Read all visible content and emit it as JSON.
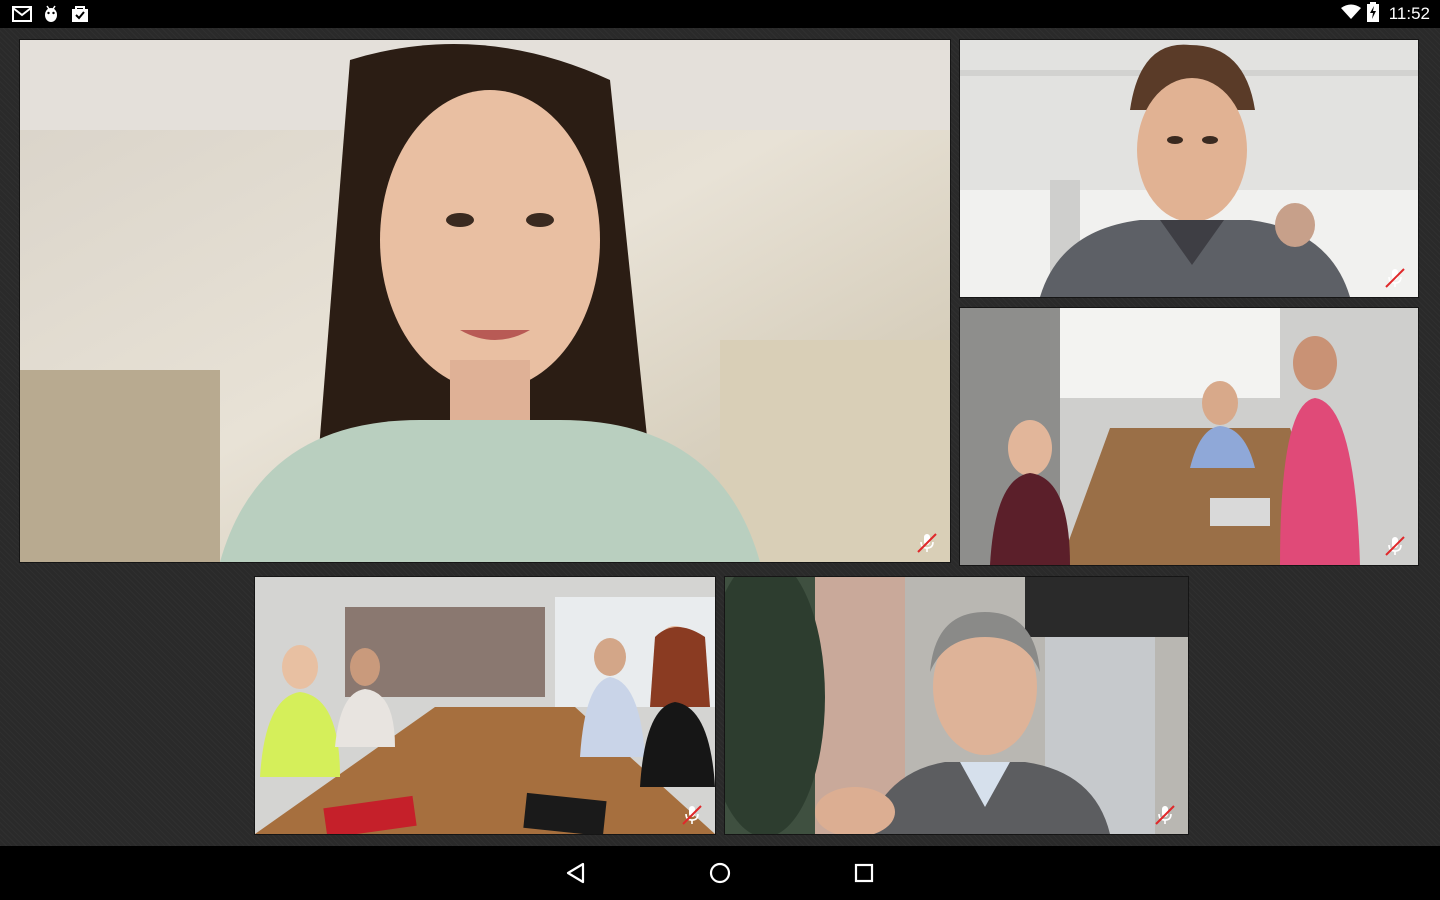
{
  "status_bar": {
    "time": "11:52",
    "left_icons": [
      "gmail-icon",
      "android-debug-icon",
      "store-bag-icon"
    ],
    "right_icons": [
      "wifi-icon",
      "battery-charging-icon"
    ]
  },
  "video_tiles": [
    {
      "name": "woman-closeup",
      "role": "active-speaker",
      "muted": true
    },
    {
      "name": "man-sweater",
      "muted": true
    },
    {
      "name": "conference-room-small",
      "muted": true
    },
    {
      "name": "conference-room-large",
      "muted": true
    },
    {
      "name": "man-outdoors",
      "muted": true
    }
  ],
  "colors": {
    "background": "#2a2a2a",
    "bars": "#000000",
    "mute_red": "#e0282a"
  },
  "nav_bar": {
    "icons": [
      "back-icon",
      "home-icon",
      "recents-icon"
    ]
  }
}
